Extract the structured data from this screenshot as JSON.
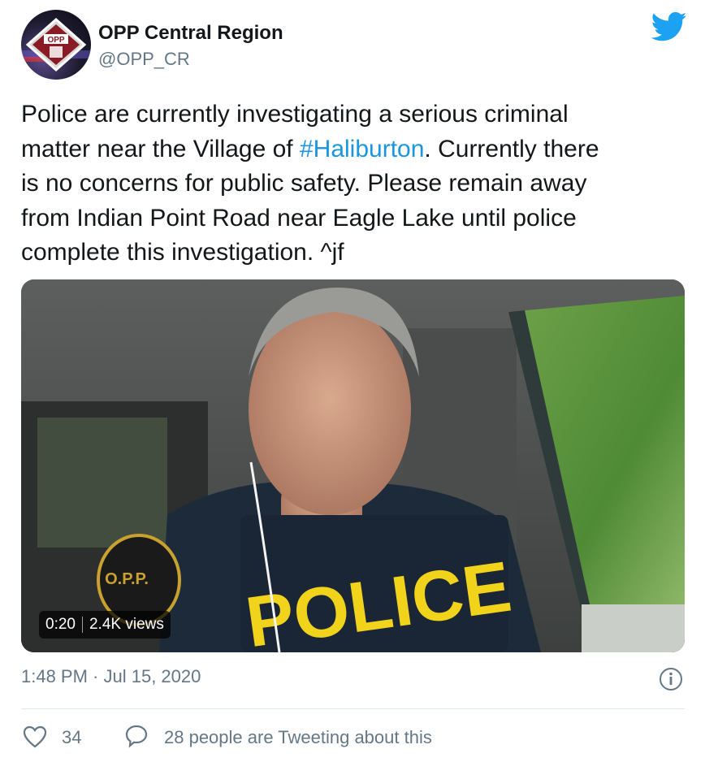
{
  "author": {
    "name": "OPP Central Region",
    "handle": "@OPP_CR",
    "avatar_text": "OPP"
  },
  "tweet": {
    "lines": [
      {
        "text": "Police are currently investigating a serious criminal"
      },
      {
        "before": "matter near the Village of ",
        "hashtag": "#Haliburton",
        "after": ". Currently there"
      },
      {
        "text": "is no concerns for public safety. Please remain away"
      },
      {
        "text": "from Indian Point Road near Eagle Lake until police"
      },
      {
        "text": "complete this investigation. ^jf"
      }
    ]
  },
  "media": {
    "duration": "0:20",
    "views": "2.4K views",
    "vest_text": "POLICE",
    "patch_text": "O.P.P."
  },
  "timestamp": "1:48 PM · Jul 15, 2020",
  "actions": {
    "likes": "34",
    "tweeting_text": "28 people are Tweeting about this"
  },
  "colors": {
    "twitter_blue": "#1da1f2",
    "hashtag": "#1b95e0",
    "secondary_text": "#657786",
    "vest_yellow": "#f2d31b"
  },
  "icons": {
    "brand": "twitter-bird-icon",
    "info": "info-icon",
    "like": "heart-icon",
    "reply": "speech-bubble-icon"
  }
}
